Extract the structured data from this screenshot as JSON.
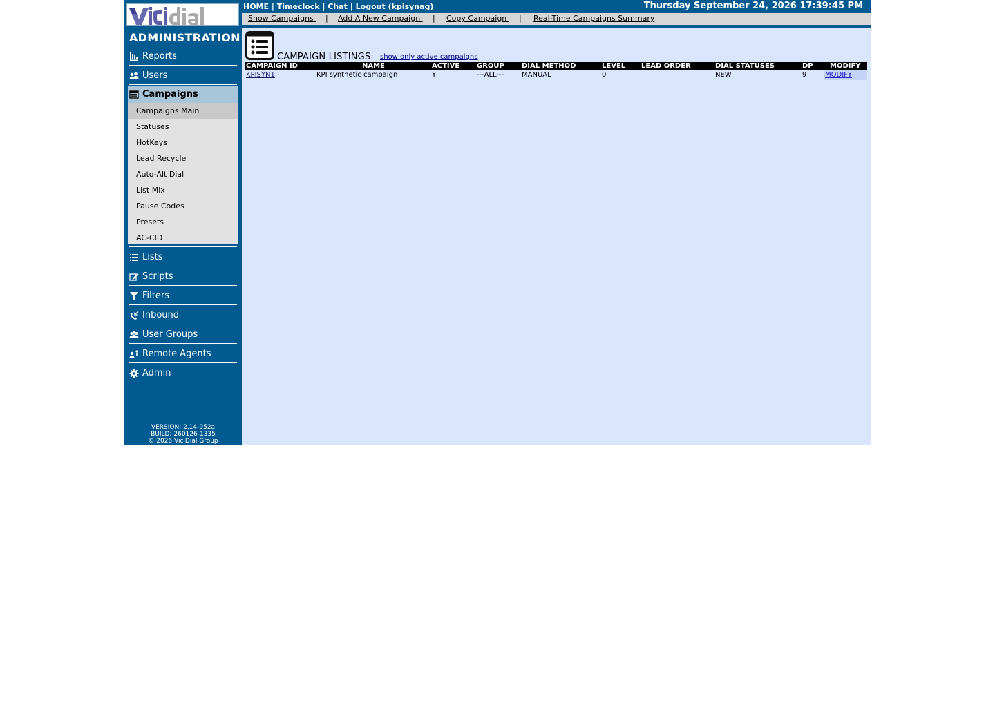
{
  "sidebar": {
    "logo_text": "VICIdial",
    "admin_title": "ADMINISTRATION",
    "nav_items": [
      {
        "label": "Reports",
        "icon": "reports-icon"
      },
      {
        "label": "Users",
        "icon": "users-icon"
      },
      {
        "label": "Campaigns",
        "icon": "campaigns-icon"
      },
      {
        "label": "Lists",
        "icon": "lists-icon"
      },
      {
        "label": "Scripts",
        "icon": "scripts-icon"
      },
      {
        "label": "Filters",
        "icon": "filter-icon"
      },
      {
        "label": "Inbound",
        "icon": "inbound-icon"
      },
      {
        "label": "User Groups",
        "icon": "user-groups-icon"
      },
      {
        "label": "Remote Agents",
        "icon": "remote-agents-icon"
      },
      {
        "label": "Admin",
        "icon": "gear-icon"
      }
    ],
    "campaign_submenu": [
      "Campaigns Main",
      "Statuses",
      "HotKeys",
      "Lead Recycle",
      "Auto-Alt Dial",
      "List Mix",
      "Pause Codes",
      "Presets",
      "AC-CID"
    ],
    "version_lines": [
      "VERSION: 2.14-952a",
      "BUILD: 260126-1335",
      "© 2026 ViciDial Group"
    ]
  },
  "topbar": {
    "home": "HOME",
    "timeclock": "Timeclock",
    "chat": "Chat",
    "logout": "Logout (kpisynag)",
    "separator": "|",
    "datetime": "Thursday September 24, 2026 17:39:45 PM"
  },
  "subnav": {
    "show_campaigns": "Show Campaigns ",
    "add_campaign": "Add A New Campaign ",
    "copy_campaign": "Copy Campaign ",
    "realtime_summary": "Real-Time Campaigns Summary",
    "separator": "|"
  },
  "main": {
    "listing_title": "CAMPAIGN LISTINGS:",
    "active_only_link": "show only active campaigns",
    "table": {
      "headers": [
        "CAMPAIGN ID",
        "NAME",
        "ACTIVE",
        "GROUP",
        "DIAL METHOD",
        "LEVEL",
        "LEAD ORDER",
        "DIAL STATUSES",
        "DP",
        "MODIFY"
      ],
      "rows": [
        [
          "KPISYN1",
          "KPI synthetic campaign",
          "Y",
          "---ALL---",
          "MANUAL",
          "0",
          "",
          "NEW",
          "9",
          "MODIFY"
        ]
      ]
    }
  }
}
